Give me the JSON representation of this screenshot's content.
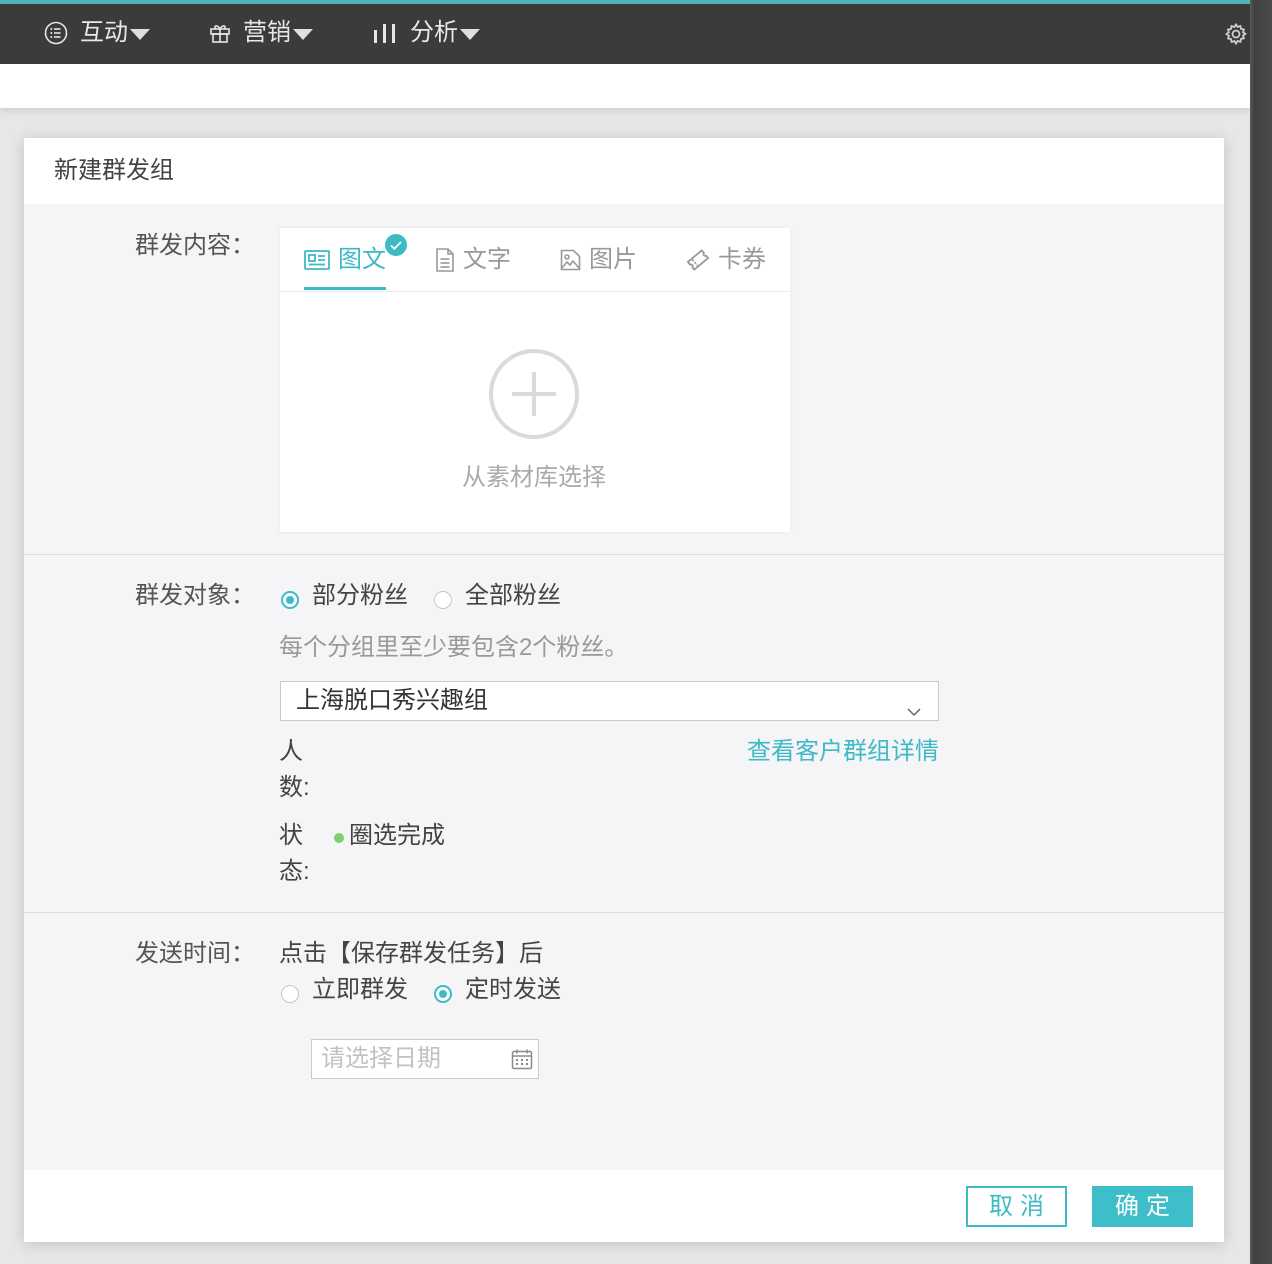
{
  "nav": {
    "items": [
      {
        "label": "互动",
        "icon": "list-circle-icon"
      },
      {
        "label": "营销",
        "icon": "gift-icon"
      },
      {
        "label": "分析",
        "icon": "bar-chart-icon"
      }
    ],
    "settings_icon": "gear-icon"
  },
  "dialog": {
    "title": "新建群发组",
    "content": {
      "label": "群发内容：",
      "tabs": [
        {
          "label": "图文",
          "icon": "article-icon",
          "active": true
        },
        {
          "label": "文字",
          "icon": "document-icon",
          "active": false
        },
        {
          "label": "图片",
          "icon": "image-icon",
          "active": false
        },
        {
          "label": "卡券",
          "icon": "ticket-icon",
          "active": false
        }
      ],
      "add_from_library": "从素材库选择"
    },
    "audience": {
      "label": "群发对象：",
      "options": [
        {
          "label": "部分粉丝",
          "checked": true
        },
        {
          "label": "全部粉丝",
          "checked": false
        }
      ],
      "hint": "每个分组里至少要包含2个粉丝。",
      "group_select_value": "上海脱口秀兴趣组",
      "count_label": "人数:",
      "group_detail_link": "查看客户群组详情",
      "status_label": "状态:",
      "status_value": "圈选完成"
    },
    "send_time": {
      "label": "发送时间：",
      "description": "点击【保存群发任务】后",
      "options": [
        {
          "label": "立即群发",
          "checked": false
        },
        {
          "label": "定时发送",
          "checked": true
        }
      ],
      "date_placeholder": "请选择日期"
    },
    "footer": {
      "cancel_label": "取消",
      "confirm_label": "确定"
    }
  },
  "colors": {
    "nav_bg": "#3b3b3b",
    "accent": "#3cbac6",
    "confirm": "#3dbec8",
    "status_dot": "#7ecf6e"
  }
}
